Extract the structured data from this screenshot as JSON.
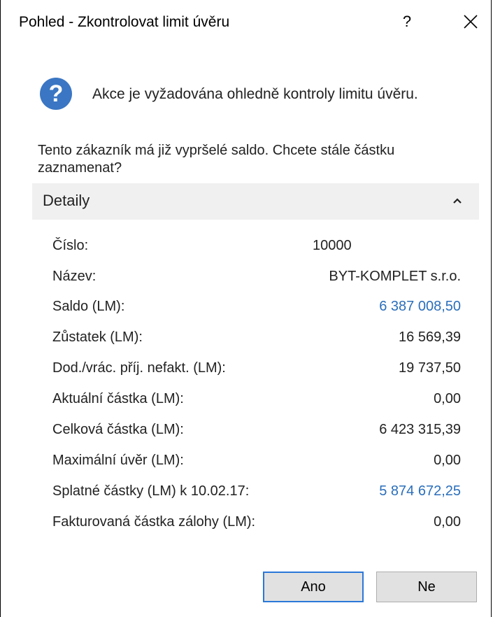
{
  "window": {
    "title": "Pohled - Zkontrolovat limit úvěru",
    "help_label": "?"
  },
  "icon": {
    "name": "question-icon",
    "glyph": "?",
    "color": "#3a76c3"
  },
  "headline": "Akce je vyžadována ohledně kontroly limitu úvěru.",
  "message": "Tento zákazník má již vypršelé saldo. Chcete stále částku zaznamenat?",
  "details": {
    "label": "Detaily",
    "rows": [
      {
        "label": "Číslo:",
        "value": "10000"
      },
      {
        "label": "Název:",
        "value": "BYT-KOMPLET s.r.o."
      },
      {
        "label": "Saldo (LM):",
        "value": "6 387 008,50"
      },
      {
        "label": "Zůstatek (LM):",
        "value": "16 569,39"
      },
      {
        "label": "Dod./vrác. příj. nefakt. (LM):",
        "value": "19 737,50"
      },
      {
        "label": "Aktuální částka (LM):",
        "value": "0,00"
      },
      {
        "label": "Celková částka (LM):",
        "value": "6 423 315,39"
      },
      {
        "label": "Maximální úvěr (LM):",
        "value": "0,00"
      },
      {
        "label": "Splatné částky (LM) k 10.02.17:",
        "value": "5 874 672,25"
      },
      {
        "label": "Fakturovaná částka zálohy (LM):",
        "value": "0,00"
      }
    ]
  },
  "buttons": {
    "yes": "Ano",
    "no": "Ne"
  },
  "colors": {
    "accent": "#2b78d8",
    "link": "#2a6ebb",
    "section_bg": "#f0f0f0"
  }
}
